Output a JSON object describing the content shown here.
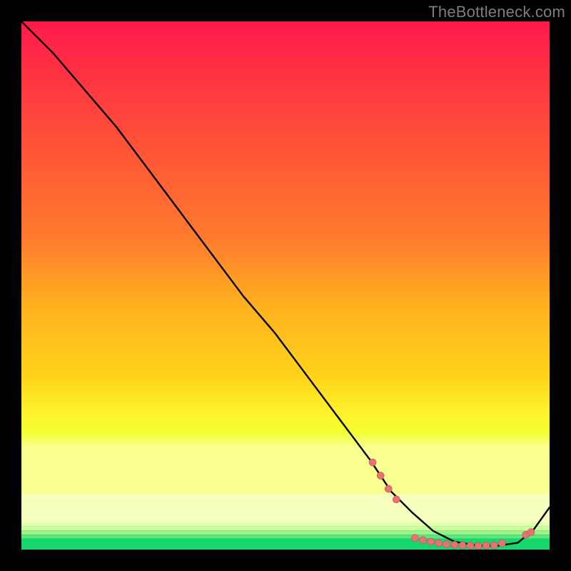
{
  "watermark": "TheBottleneck.com",
  "chart_data": {
    "type": "line",
    "title": "",
    "xlabel": "",
    "ylabel": "",
    "xlim": [
      0,
      100
    ],
    "ylim": [
      0,
      100
    ],
    "background_gradient": {
      "top_color": "#ff1a4b",
      "upper_mid_color": "#ff7a2e",
      "mid_color": "#ffd31a",
      "lower_mid_color": "#f3ff33",
      "pale_band_color": "#f7ffbf",
      "bottom_color": "#17d66b"
    },
    "series": [
      {
        "name": "bottleneck-curve",
        "color": "#000000",
        "x": [
          0,
          6,
          12,
          18,
          24,
          30,
          36,
          42,
          48,
          54,
          60,
          66,
          70,
          74,
          78,
          82,
          86,
          90,
          94,
          97,
          100
        ],
        "y": [
          100,
          94,
          87,
          80,
          72,
          64,
          56,
          48,
          41,
          33,
          25,
          17,
          11,
          7,
          3.5,
          1.5,
          0.8,
          0.7,
          1.3,
          3.8,
          8
        ]
      }
    ],
    "markers": {
      "name": "highlight-points",
      "color": "#e57373",
      "radius": 5,
      "points": [
        {
          "x": 66.5,
          "y": 16.5
        },
        {
          "x": 68.0,
          "y": 14.0
        },
        {
          "x": 69.5,
          "y": 11.5
        },
        {
          "x": 71.0,
          "y": 9.5
        },
        {
          "x": 74.5,
          "y": 2.2
        },
        {
          "x": 76.0,
          "y": 1.8
        },
        {
          "x": 77.5,
          "y": 1.5
        },
        {
          "x": 79.0,
          "y": 1.2
        },
        {
          "x": 80.5,
          "y": 1.0
        },
        {
          "x": 82.0,
          "y": 0.9
        },
        {
          "x": 83.5,
          "y": 0.8
        },
        {
          "x": 85.0,
          "y": 0.75
        },
        {
          "x": 86.5,
          "y": 0.7
        },
        {
          "x": 88.0,
          "y": 0.75
        },
        {
          "x": 89.5,
          "y": 0.8
        },
        {
          "x": 91.0,
          "y": 1.2
        },
        {
          "x": 95.5,
          "y": 2.8
        },
        {
          "x": 96.5,
          "y": 3.3
        }
      ]
    }
  }
}
